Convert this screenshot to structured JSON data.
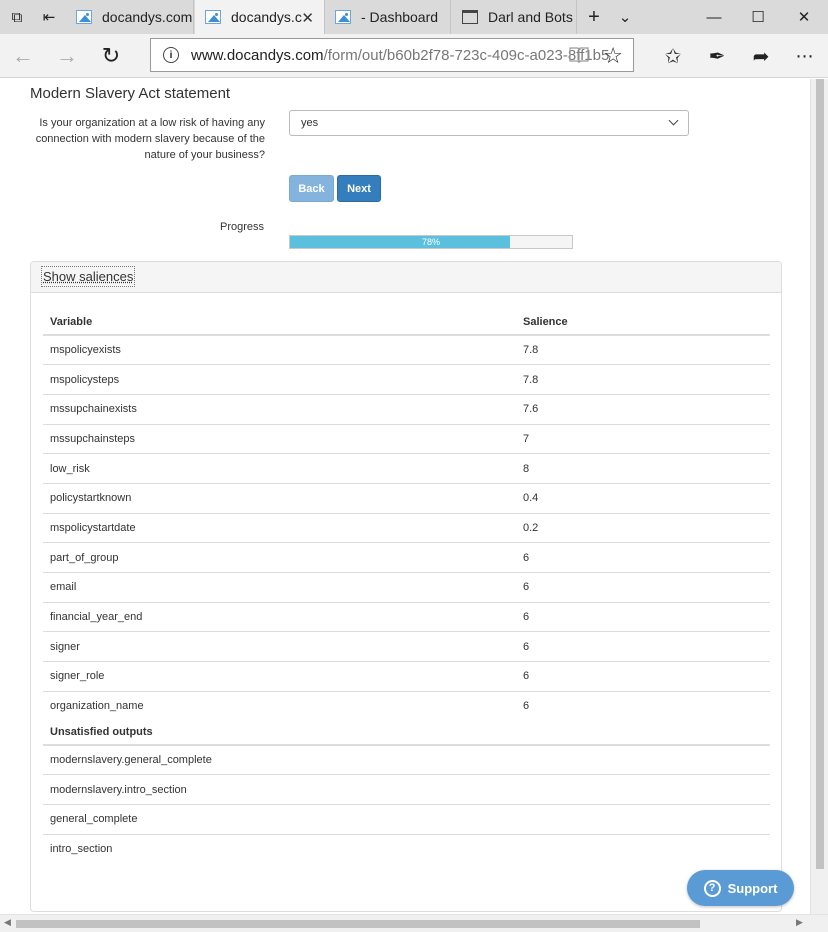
{
  "browser": {
    "tabs": [
      {
        "label": "docandys.com",
        "icon": "image-favicon-icon"
      },
      {
        "label": "docandys.c",
        "icon": "image-favicon-icon"
      },
      {
        "label": "- Dashboard",
        "icon": "image-favicon-icon"
      },
      {
        "label": "Darl and Bots",
        "icon": "window-favicon-icon"
      }
    ],
    "url_host": "www.docandys.com",
    "url_path": "/form/out/b60b2f78-723c-409c-a023-8ff1b5"
  },
  "form": {
    "title": "Modern Slavery Act statement",
    "question": "Is your organization at a low risk of having any connection with modern slavery because of the nature of your business?",
    "answer": "yes",
    "back_label": "Back",
    "next_label": "Next",
    "progress_label": "Progress",
    "progress_value": 0.78,
    "progress_text": "78%"
  },
  "saliences": {
    "toggle_label": "Show saliences",
    "headers": {
      "variable": "Variable",
      "salience": "Salience"
    },
    "rows": [
      {
        "variable": "mspolicyexists",
        "salience": "7.8"
      },
      {
        "variable": "mspolicysteps",
        "salience": "7.8"
      },
      {
        "variable": "mssupchainexists",
        "salience": "7.6"
      },
      {
        "variable": "mssupchainsteps",
        "salience": "7"
      },
      {
        "variable": "low_risk",
        "salience": "8"
      },
      {
        "variable": "policystartknown",
        "salience": "0.4"
      },
      {
        "variable": "mspolicystartdate",
        "salience": "0.2"
      },
      {
        "variable": "part_of_group",
        "salience": "6"
      },
      {
        "variable": "email",
        "salience": "6"
      },
      {
        "variable": "financial_year_end",
        "salience": "6"
      },
      {
        "variable": "signer",
        "salience": "6"
      },
      {
        "variable": "signer_role",
        "salience": "6"
      },
      {
        "variable": "organization_name",
        "salience": "6"
      }
    ]
  },
  "outputs": {
    "header": "Unsatisfied outputs",
    "rows": [
      "modernslavery.general_complete",
      "modernslavery.intro_section",
      "general_complete",
      "intro_section"
    ]
  },
  "support": {
    "label": "Support"
  },
  "colors": {
    "primary": "#357ebd",
    "progress": "#5bc0de",
    "support": "#5b9bd5"
  }
}
